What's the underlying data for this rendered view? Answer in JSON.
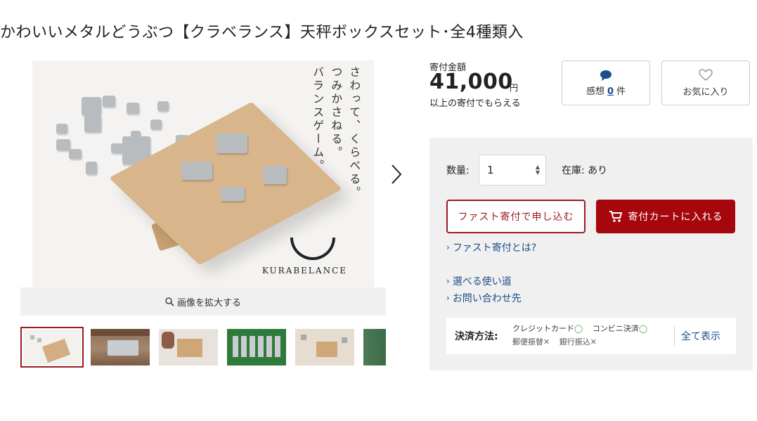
{
  "product": {
    "title": "かわいいメタルどうぶつ【クラベランス】天秤ボックスセット･全4種類入"
  },
  "gallery": {
    "main_image": {
      "vertical_text": [
        "さわって、くらべる。",
        "つみかさねる。",
        "バランスゲーム。"
      ],
      "logo_text": "KURABELANCE"
    },
    "zoom_label": "画像を拡大する",
    "thumbnail_count": 6,
    "selected_index": 0
  },
  "price": {
    "label": "寄付金額",
    "amount": "41,000",
    "unit": "円",
    "suffix": "以上の寄付でもらえる"
  },
  "reviews": {
    "label": "感想",
    "count": "0",
    "unit": "件"
  },
  "favorite": {
    "label": "お気に入り"
  },
  "purchase": {
    "quantity_label": "数量:",
    "quantity_value": "1",
    "stock_label": "在庫:",
    "stock_value": "あり",
    "fast_button": "ファスト寄付で申し込む",
    "cart_button": "寄付カートに入れる",
    "fast_link": "ファスト寄付とは?",
    "usage_link": "選べる使い道",
    "contact_link": "お問い合わせ先"
  },
  "payment": {
    "label": "決済方法:",
    "methods": [
      {
        "name": "クレジットカード",
        "mark": "◯"
      },
      {
        "name": "コンビニ決済",
        "mark": "◯"
      },
      {
        "name": "郵便振替",
        "mark": "✕"
      },
      {
        "name": "銀行振込",
        "mark": "✕"
      }
    ],
    "show_all": "全て表示"
  },
  "colors": {
    "accent_red": "#a5070d",
    "link_blue": "#1d4d8c",
    "panel_bg": "#f0f0f0",
    "ok_green": "#3aa24a"
  }
}
